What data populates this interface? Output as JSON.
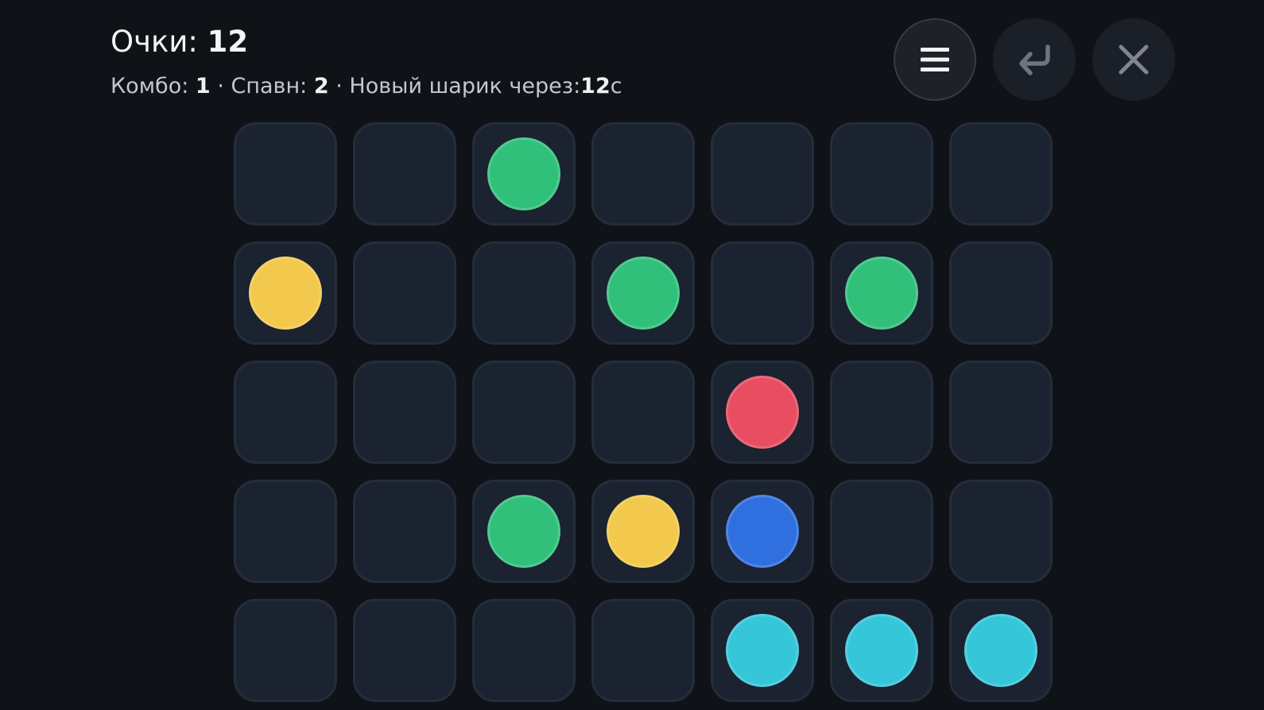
{
  "header": {
    "score_label": "Очки:",
    "score_value": "12",
    "combo_label": "Комбо:",
    "combo_value": "1",
    "separator": "·",
    "spawn_label": "Спавн:",
    "spawn_value": "2",
    "next_ball_label": "Новый шарик через:",
    "next_ball_value": "12",
    "next_ball_unit": "с"
  },
  "controls": {
    "menu_icon": "hamburger-menu-icon",
    "undo_icon": "undo-return-icon",
    "close_icon": "close-x-icon"
  },
  "palette": {
    "green": "#31c07a",
    "yellow": "#f2c94c",
    "red": "#e84d61",
    "blue": "#2f6fe0",
    "cyan": "#35c6d9"
  },
  "board": {
    "columns": 7,
    "rows": 5,
    "cells": [
      [
        null,
        null,
        "green",
        null,
        null,
        null,
        null
      ],
      [
        "yellow",
        null,
        null,
        "green",
        null,
        "green",
        null
      ],
      [
        null,
        null,
        null,
        null,
        "red",
        null,
        null
      ],
      [
        null,
        null,
        "green",
        "yellow",
        "blue",
        null,
        null
      ],
      [
        null,
        null,
        null,
        null,
        "cyan",
        "cyan",
        "cyan"
      ]
    ]
  }
}
